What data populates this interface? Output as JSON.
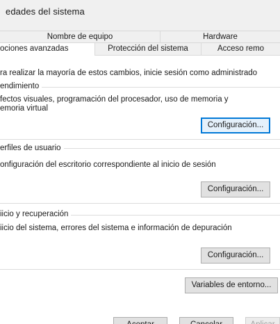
{
  "window": {
    "title": "edades del sistema"
  },
  "tabs": {
    "row1": [
      "Nombre de equipo",
      "Hardware"
    ],
    "row2": [
      "ociones avanzadas",
      "Protección del sistema",
      "Acceso remo"
    ]
  },
  "note": "ra realizar la mayoría de estos cambios, inicie sesión como administrado",
  "groups": [
    {
      "label": "endimiento",
      "desc_line1": "fectos visuales, programación del procesador, uso de memoria y",
      "desc_line2": "emoria virtual",
      "button": "Configuración..."
    },
    {
      "label": "erfiles de usuario",
      "desc_line1": "onfiguración del escritorio correspondiente al inicio de sesión",
      "button": "Configuración..."
    },
    {
      "label": "iicio y recuperación",
      "desc_line1": "iicio del sistema, errores del sistema e información de depuración",
      "button": "Configuración..."
    }
  ],
  "env_button": "Variables de entorno...",
  "footer": {
    "ok": "Aceptar",
    "cancel": "Cancelar",
    "apply": "Aplicar"
  }
}
